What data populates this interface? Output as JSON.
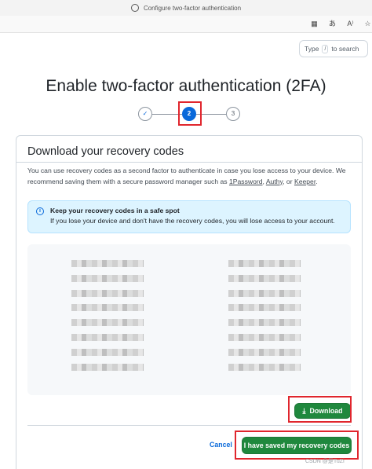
{
  "browser": {
    "tab_title": "Configure two-factor authentication",
    "icons": [
      "layout-icon",
      "translate-icon",
      "read-aloud-icon",
      "favorites-icon"
    ]
  },
  "search": {
    "placeholder_prefix": "Type",
    "shortcut": "/",
    "placeholder_suffix": "to search"
  },
  "heading": "Enable two-factor authentication (2FA)",
  "stepper": {
    "steps": [
      {
        "label": "✓",
        "state": "done"
      },
      {
        "label": "2",
        "state": "active"
      },
      {
        "label": "3",
        "state": "pending"
      }
    ]
  },
  "recovery": {
    "title": "Download your recovery codes",
    "description_part1": "You can use recovery codes as a second factor to authenticate in case you lose access to your device. We recommend saving them with a secure password manager such as",
    "link_1password": "1Password",
    "comma1": ",",
    "link_authy": "Authy",
    "or_text": ", or",
    "link_keeper": "Keeper",
    "period": ".",
    "flash_title": "Keep your recovery codes in a safe spot",
    "flash_body": "If you lose your device and don't have the recovery codes, you will lose access to your account.",
    "download_label": "Download",
    "cancel_label": "Cancel",
    "saved_label": "I have saved my recovery codes"
  },
  "watermark": "CSDN @是TuZi",
  "colors": {
    "primary_green": "#1f883d",
    "accent_blue": "#0969da",
    "annotation_red": "#e0262d",
    "flash_bg": "#ddf4ff"
  }
}
